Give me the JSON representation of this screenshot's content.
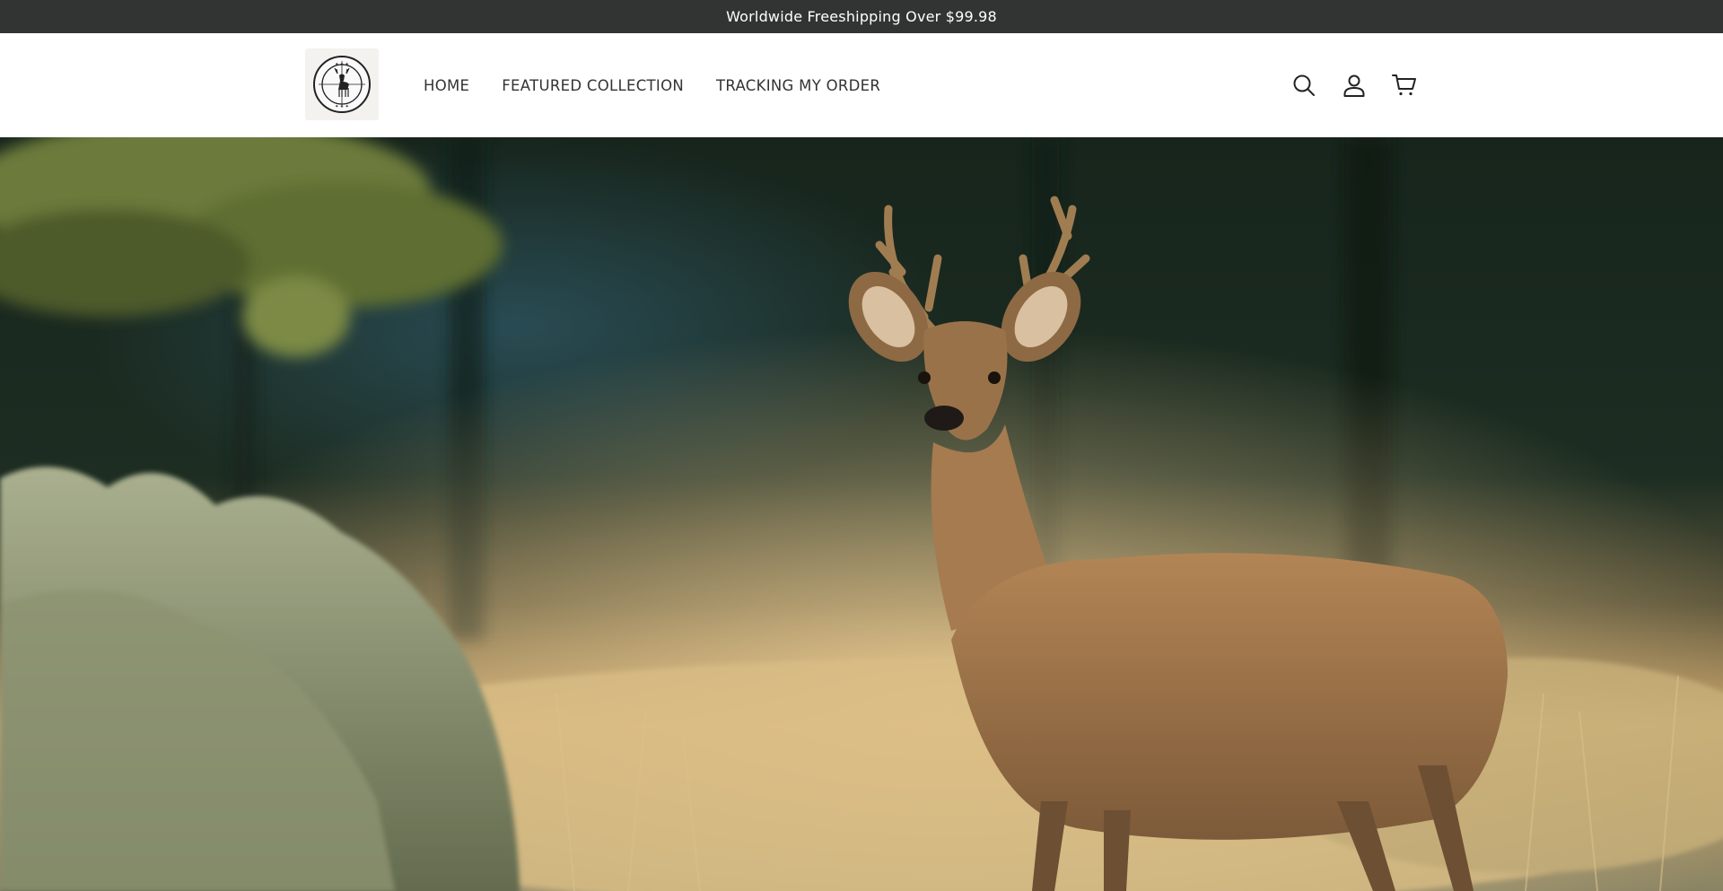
{
  "announcement": {
    "text": "Worldwide Freeshipping Over $99.98"
  },
  "header": {
    "logo": {
      "alt": "store logo",
      "icon": "deer-emblem-icon"
    },
    "nav": [
      {
        "label": "HOME"
      },
      {
        "label": "FEATURED COLLECTION"
      },
      {
        "label": "TRACKING MY ORDER"
      }
    ],
    "icons": [
      "search-icon",
      "account-icon",
      "cart-icon"
    ]
  },
  "hero": {
    "image": "deer-in-meadow-photo",
    "alt": "Deer standing in a golden grass meadow"
  },
  "colors": {
    "announcement_bg": "#323434",
    "header_bg": "#ffffff",
    "text": "#333333"
  }
}
